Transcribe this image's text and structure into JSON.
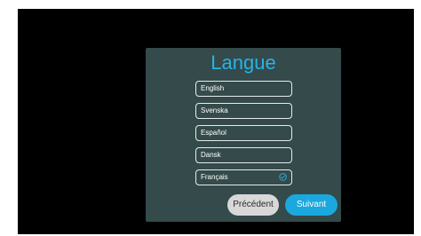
{
  "dialog": {
    "title": "Langue",
    "languages": [
      {
        "label": "English",
        "selected": false
      },
      {
        "label": "Svenska",
        "selected": false
      },
      {
        "label": "Español",
        "selected": false
      },
      {
        "label": "Dansk",
        "selected": false
      },
      {
        "label": "Français",
        "selected": true
      }
    ],
    "previous_label": "Précédent",
    "next_label": "Suivant"
  },
  "colors": {
    "screen_background": "#000000",
    "dialog_background": "#344a4b",
    "accent": "#29b2e5",
    "next_button": "#1ba8de",
    "previous_button": "#d8d8d8"
  },
  "icons": {
    "selected_marker": "check-circle-icon"
  }
}
